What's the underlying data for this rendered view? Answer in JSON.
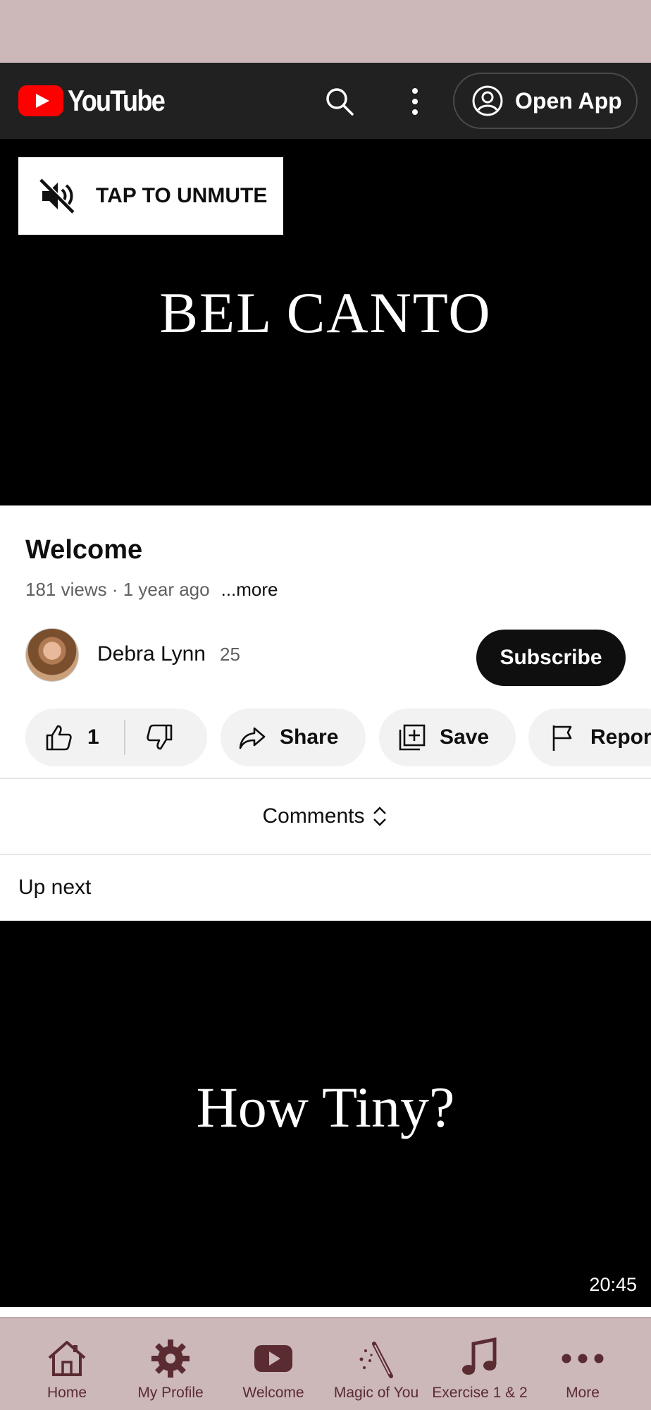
{
  "header": {
    "logo_text": "YouTube",
    "open_app_label": "Open App"
  },
  "player": {
    "unmute_label": "TAP TO UNMUTE",
    "title_card": "BEL CANTO"
  },
  "video": {
    "title": "Welcome",
    "meta": "181 views · 1 year ago",
    "more_label": "...more"
  },
  "channel": {
    "name": "Debra Lynn",
    "subscriber_count": "25",
    "subscribe_label": "Subscribe"
  },
  "actions": {
    "like_count": "1",
    "share_label": "Share",
    "save_label": "Save",
    "report_label": "Report"
  },
  "comments_label": "Comments",
  "up_next_label": "Up next",
  "next_video": {
    "title_card": "How Tiny?",
    "duration": "20:45"
  },
  "tabs": [
    {
      "label": "Home",
      "icon": "home-icon"
    },
    {
      "label": "My Profile",
      "icon": "gear-icon"
    },
    {
      "label": "Welcome",
      "icon": "youtube-icon"
    },
    {
      "label": "Magic of You",
      "icon": "magic-wand-icon"
    },
    {
      "label": "Exercise 1 & 2",
      "icon": "music-note-icon"
    },
    {
      "label": "More",
      "icon": "more-horiz-icon"
    }
  ],
  "colors": {
    "tab_bar_bg": "#ccb7b9",
    "tab_accent": "#5a2b31",
    "brand_red": "#ff0000",
    "header_bg": "#212121"
  }
}
